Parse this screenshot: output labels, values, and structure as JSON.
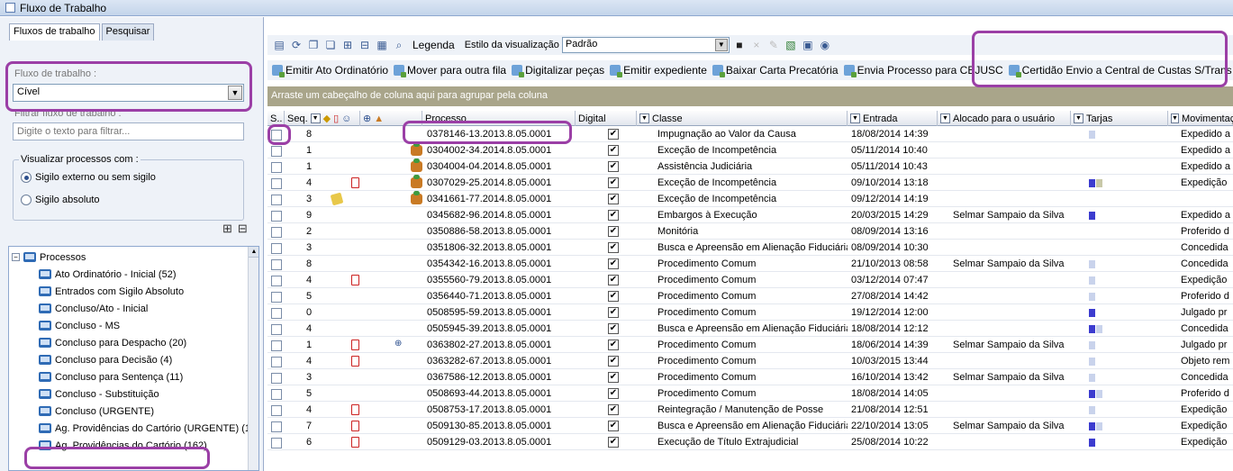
{
  "window": {
    "title": "Fluxo de Trabalho"
  },
  "left_panel": {
    "tabs": [
      "Fluxos de trabalho",
      "Pesquisar"
    ],
    "workflow_label": "Fluxo de trabalho :",
    "workflow_value": "Cível",
    "filter_label": "Filtrar fluxo de trabalho :",
    "filter_placeholder": "Digite o texto para filtrar...",
    "visibility_legend": "Visualizar processos com :",
    "visibility_options": [
      "Sigilo externo ou sem sigilo",
      "Sigilo absoluto"
    ],
    "visibility_selected": 0,
    "tree": {
      "root": "Processos",
      "items": [
        "Ato Ordinatório - Inicial (52)",
        "Entrados com Sigilo Absoluto",
        "Concluso/Ato - Inicial",
        "Concluso - MS",
        "Concluso para Despacho (20)",
        "Concluso para Decisão (4)",
        "Concluso para Sentença (11)",
        "Concluso - Substituição",
        "Concluso (URGENTE)",
        "Ag. Providências do Cartório (URGENTE) (16)",
        "Ag. Providências do Cartório (162)"
      ]
    }
  },
  "toolbar": {
    "legend_label": "Legenda",
    "view_style_label": "Estilo da visualização",
    "view_style_value": "Padrão",
    "actions": [
      "Emitir Ato Ordinatório",
      "Mover para outra fila",
      "Digitalizar peças",
      "Emitir expediente",
      "Baixar Carta Precatória",
      "Envia Processo para CEJUSC",
      "Certidão Envio a Central de Custas S/Trans Julgado"
    ]
  },
  "grid": {
    "group_hint": "Arraste um cabeçalho de coluna aqui para agrupar pela coluna",
    "columns": {
      "sel": "S..",
      "seq": "Seq.",
      "processo": "Processo",
      "digital": "Digital",
      "classe": "Classe",
      "entrada": "Entrada",
      "alocado": "Alocado para o usuário",
      "tarjas": "Tarjas",
      "movimentacao": "Movimentação"
    },
    "rows": [
      {
        "seq": "8",
        "processo": "0378146-13.2013.8.05.0001",
        "classe": "Impugnação ao Valor da Causa",
        "entrada": "18/08/2014 14:39",
        "alocado": "",
        "mov": "Expedido a",
        "icons": [],
        "tarjas": [
          "#c9d3ec"
        ]
      },
      {
        "seq": "1",
        "processo": "0304002-34.2014.8.05.0001",
        "classe": "Exceção de Incompetência",
        "entrada": "05/11/2014 10:40",
        "alocado": "",
        "mov": "Expedido a",
        "icons": [
          "sig"
        ],
        "tarjas": []
      },
      {
        "seq": "1",
        "processo": "0304004-04.2014.8.05.0001",
        "classe": "Assistência Judiciária",
        "entrada": "05/11/2014 10:43",
        "alocado": "",
        "mov": "Expedido a",
        "icons": [
          "sig"
        ],
        "tarjas": []
      },
      {
        "seq": "4",
        "processo": "0307029-25.2014.8.05.0001",
        "classe": "Exceção de Incompetência",
        "entrada": "09/10/2014 13:18",
        "alocado": "",
        "mov": "Expedição",
        "icons": [
          "doc",
          "sig"
        ],
        "tarjas": [
          "#3c3ccf",
          "#c8c8a8"
        ]
      },
      {
        "seq": "3",
        "processo": "0341661-77.2014.8.05.0001",
        "classe": "Exceção de Incompetência",
        "entrada": "09/12/2014 14:19",
        "alocado": "",
        "mov": "",
        "icons": [
          "note",
          "sig"
        ],
        "tarjas": []
      },
      {
        "seq": "9",
        "processo": "0345682-96.2014.8.05.0001",
        "classe": "Embargos à Execução",
        "entrada": "20/03/2015 14:29",
        "alocado": "Selmar Sampaio da Silva",
        "mov": "Expedido a",
        "icons": [],
        "tarjas": [
          "#3c3ccf"
        ]
      },
      {
        "seq": "2",
        "processo": "0350886-58.2013.8.05.0001",
        "classe": "Monitória",
        "entrada": "08/09/2014 13:16",
        "alocado": "",
        "mov": "Proferido d",
        "icons": [],
        "tarjas": []
      },
      {
        "seq": "3",
        "processo": "0351806-32.2013.8.05.0001",
        "classe": "Busca e Apreensão em Alienação Fiduciária",
        "entrada": "08/09/2014 10:30",
        "alocado": "",
        "mov": "Concedida",
        "icons": [],
        "tarjas": []
      },
      {
        "seq": "8",
        "processo": "0354342-16.2013.8.05.0001",
        "classe": "Procedimento Comum",
        "entrada": "21/10/2013 08:58",
        "alocado": "Selmar Sampaio da Silva",
        "mov": "Concedida",
        "icons": [],
        "tarjas": [
          "#c9d3ec"
        ]
      },
      {
        "seq": "4",
        "processo": "0355560-79.2013.8.05.0001",
        "classe": "Procedimento Comum",
        "entrada": "03/12/2014 07:47",
        "alocado": "",
        "mov": "Expedição",
        "icons": [
          "doc"
        ],
        "tarjas": [
          "#c9d3ec"
        ]
      },
      {
        "seq": "5",
        "processo": "0356440-71.2013.8.05.0001",
        "classe": "Procedimento Comum",
        "entrada": "27/08/2014 14:42",
        "alocado": "",
        "mov": "Proferido d",
        "icons": [],
        "tarjas": [
          "#c9d3ec"
        ]
      },
      {
        "seq": "0",
        "processo": "0508595-59.2013.8.05.0001",
        "classe": "Procedimento Comum",
        "entrada": "19/12/2014 12:00",
        "alocado": "",
        "mov": "Julgado pr",
        "icons": [],
        "tarjas": [
          "#3c3ccf"
        ]
      },
      {
        "seq": "4",
        "processo": "0505945-39.2013.8.05.0001",
        "classe": "Busca e Apreensão em Alienação Fiduciária",
        "entrada": "18/08/2014 12:12",
        "alocado": "",
        "mov": "Concedida",
        "icons": [],
        "tarjas": [
          "#3c3ccf",
          "#c9d3ec"
        ]
      },
      {
        "seq": "1",
        "processo": "0363802-27.2013.8.05.0001",
        "classe": "Procedimento Comum",
        "entrada": "18/06/2014 14:39",
        "alocado": "Selmar Sampaio da Silva",
        "mov": "Julgado pr",
        "icons": [
          "doc",
          "link"
        ],
        "tarjas": [
          "#c9d3ec"
        ]
      },
      {
        "seq": "4",
        "processo": "0363282-67.2013.8.05.0001",
        "classe": "Procedimento Comum",
        "entrada": "10/03/2015 13:44",
        "alocado": "",
        "mov": "Objeto rem",
        "icons": [
          "doc"
        ],
        "tarjas": [
          "#c9d3ec"
        ]
      },
      {
        "seq": "3",
        "processo": "0367586-12.2013.8.05.0001",
        "classe": "Procedimento Comum",
        "entrada": "16/10/2014 13:42",
        "alocado": "Selmar Sampaio da Silva",
        "mov": "Concedida",
        "icons": [],
        "tarjas": [
          "#c9d3ec"
        ]
      },
      {
        "seq": "5",
        "processo": "0508693-44.2013.8.05.0001",
        "classe": "Procedimento Comum",
        "entrada": "18/08/2014 14:05",
        "alocado": "",
        "mov": "Proferido d",
        "icons": [],
        "tarjas": [
          "#3c3ccf",
          "#c9d3ec"
        ]
      },
      {
        "seq": "4",
        "processo": "0508753-17.2013.8.05.0001",
        "classe": "Reintegração / Manutenção de Posse",
        "entrada": "21/08/2014 12:51",
        "alocado": "",
        "mov": "Expedição",
        "icons": [
          "doc"
        ],
        "tarjas": [
          "#c9d3ec"
        ]
      },
      {
        "seq": "7",
        "processo": "0509130-85.2013.8.05.0001",
        "classe": "Busca e Apreensão em Alienação Fiduciária",
        "entrada": "22/10/2014 13:05",
        "alocado": "Selmar Sampaio da Silva",
        "mov": "Expedição",
        "icons": [
          "doc"
        ],
        "tarjas": [
          "#3c3ccf",
          "#c9d3ec"
        ]
      },
      {
        "seq": "6",
        "processo": "0509129-03.2013.8.05.0001",
        "classe": "Execução de Título Extrajudicial",
        "entrada": "25/08/2014 10:22",
        "alocado": "",
        "mov": "Expedição",
        "icons": [
          "doc"
        ],
        "tarjas": [
          "#3c3ccf"
        ]
      }
    ]
  },
  "colors": {
    "highlight": "#9b3fa6",
    "group_bar": "#a9a58a",
    "title_bar": "#c3d4ea"
  }
}
